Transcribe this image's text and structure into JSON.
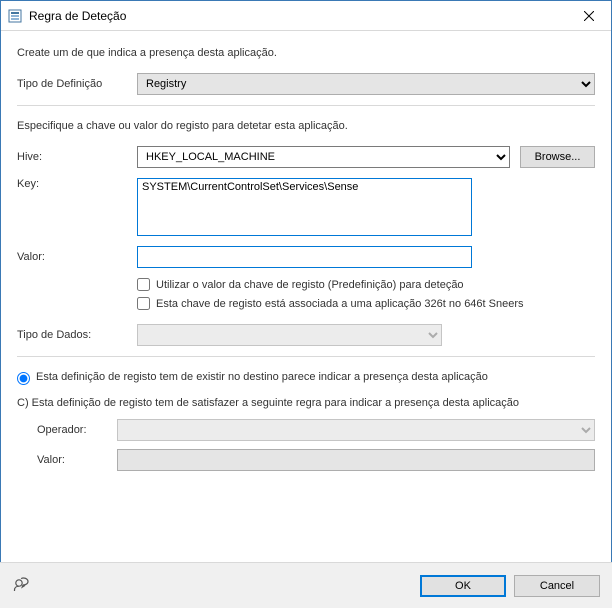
{
  "window": {
    "title": "Regra de Deteção"
  },
  "intro": "Create um de que indica a presença desta aplicação.",
  "definition_type": {
    "label": "Tipo de Definição",
    "value": "Registry"
  },
  "section2_label": "Especifique a chave ou valor do registo para detetar esta aplicação.",
  "hive": {
    "label": "Hive:",
    "value": "HKEY_LOCAL_MACHINE",
    "browse_label": "Browse..."
  },
  "key": {
    "label": "Key:",
    "value": "SYSTEM\\CurrentControlSet\\Services\\Sense"
  },
  "valor": {
    "label": "Valor:",
    "value": ""
  },
  "chk_use_default": {
    "label": "Utilizar o valor da chave de registo (Predefinição) para deteção",
    "checked": false
  },
  "chk_associated": {
    "label": "Esta chave de registo está associada a uma aplicação 326t no 646t Sneers",
    "checked": false
  },
  "data_type": {
    "label": "Tipo de Dados:",
    "value": ""
  },
  "radio_exist": {
    "label": "Esta definição de registo tem de existir no destino parece indicar a presença desta aplicação",
    "selected": true
  },
  "radio_rule": {
    "label": "C) Esta definição de registo tem de satisfazer a seguinte regra para indicar a presença desta aplicação",
    "selected": false
  },
  "operator": {
    "label": "Operador:",
    "value": ""
  },
  "rule_valor": {
    "label": "Valor:",
    "value": ""
  },
  "buttons": {
    "ok": "OK",
    "cancel": "Cancel"
  }
}
